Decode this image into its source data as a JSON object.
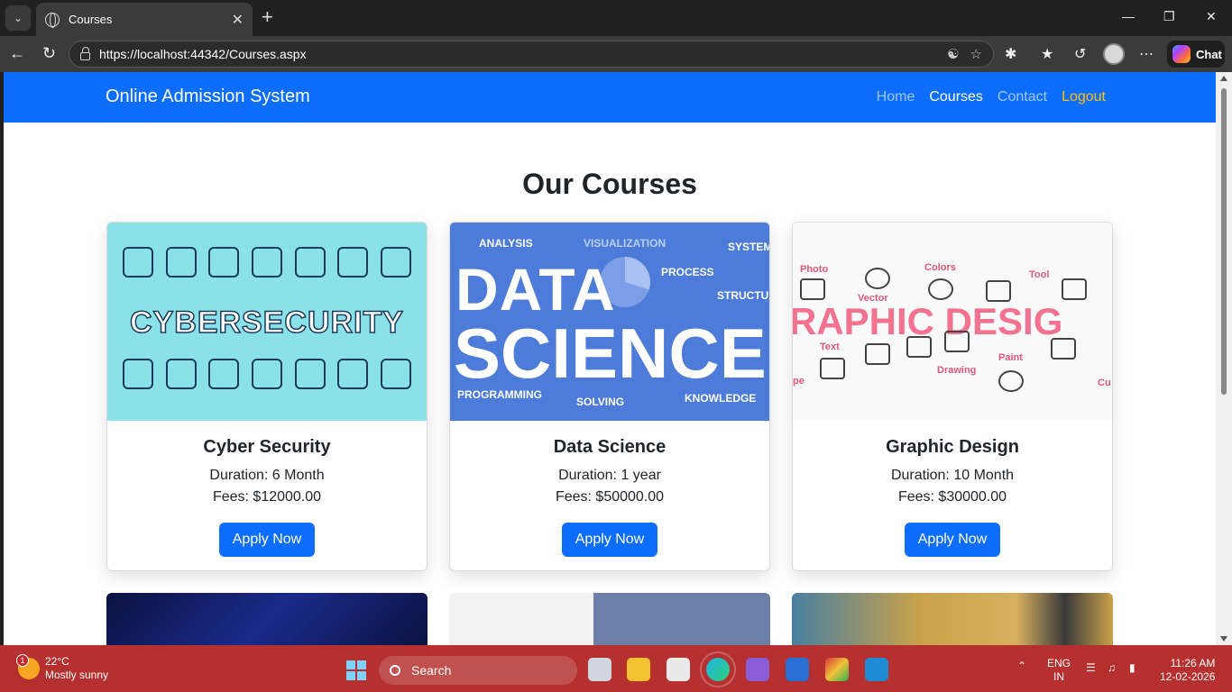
{
  "browser": {
    "tab_title": "Courses",
    "url": "https://localhost:44342/Courses.aspx",
    "chat_label": "Chat"
  },
  "site": {
    "brand": "Online Admission System",
    "nav": {
      "home": "Home",
      "courses": "Courses",
      "contact": "Contact",
      "logout": "Logout"
    },
    "heading": "Our Courses"
  },
  "courses": [
    {
      "title": "Cyber Security",
      "duration": "Duration: 6 Month",
      "fees": "Fees: $12000.00",
      "button": "Apply Now",
      "image_text": "CYBERSECURITY"
    },
    {
      "title": "Data Science",
      "duration": "Duration: 1 year",
      "fees": "Fees: $50000.00",
      "button": "Apply Now",
      "image_text_1": "DATA",
      "image_text_2": "SCIENCE",
      "image_tags": [
        "ANALYSIS",
        "VISUALIZATION",
        "SYSTEM",
        "PROCESS",
        "STRUCTURE",
        "PROGRAMMING",
        "SOLVING",
        "KNOWLEDGE"
      ]
    },
    {
      "title": "Graphic Design",
      "duration": "Duration: 10 Month",
      "fees": "Fees: $30000.00",
      "button": "Apply Now",
      "image_text": "RAPHIC DESIG",
      "image_tags": [
        "Photo",
        "Colors",
        "Tool",
        "Vector",
        "Text",
        "Drawing",
        "Paint",
        "pe",
        "Cu"
      ]
    }
  ],
  "taskbar": {
    "weather_temp": "22°C",
    "weather_desc": "Mostly sunny",
    "weather_badge": "1",
    "search_label": "Search",
    "lang_1": "ENG",
    "lang_2": "IN",
    "time": "11:26 AM",
    "date": "12-02-2026"
  },
  "colors": {
    "navbar": "#0d6efd",
    "logout": "#ffc107",
    "taskbar": "#b5302e"
  }
}
